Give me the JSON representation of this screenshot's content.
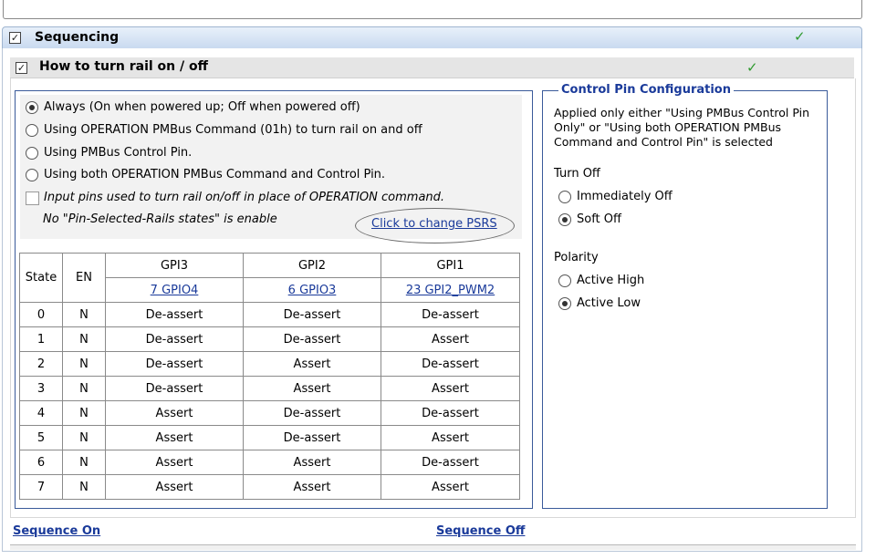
{
  "sequencing": {
    "title": "Sequencing",
    "checked": true
  },
  "how_to": {
    "title": "How to turn rail on / off",
    "checked": true
  },
  "options": [
    {
      "label": "Always (On when powered up; Off when powered off)",
      "selected": true
    },
    {
      "label": "Using OPERATION PMBus Command (01h) to turn rail on and off",
      "selected": false
    },
    {
      "label": "Using PMBus Control Pin.",
      "selected": false
    },
    {
      "label": "Using both OPERATION PMBus Command and Control Pin.",
      "selected": false
    }
  ],
  "input_pins_label": "Input pins used to turn rail on/off in place of OPERATION command.",
  "psrs_status": "No \"Pin-Selected-Rails states\" is enable",
  "psrs_link": "Click to change PSRS",
  "table": {
    "state_header": "State",
    "en_header": "EN",
    "gpi_headers": [
      "GPI3",
      "GPI2",
      "GPI1"
    ],
    "gpi_links": [
      "7 GPIO4",
      "6 GPIO3",
      "23 GPI2_PWM2"
    ],
    "rows": [
      [
        "0",
        "N",
        "De-assert",
        "De-assert",
        "De-assert"
      ],
      [
        "1",
        "N",
        "De-assert",
        "De-assert",
        "Assert"
      ],
      [
        "2",
        "N",
        "De-assert",
        "Assert",
        "De-assert"
      ],
      [
        "3",
        "N",
        "De-assert",
        "Assert",
        "Assert"
      ],
      [
        "4",
        "N",
        "Assert",
        "De-assert",
        "De-assert"
      ],
      [
        "5",
        "N",
        "Assert",
        "De-assert",
        "Assert"
      ],
      [
        "6",
        "N",
        "Assert",
        "Assert",
        "De-assert"
      ],
      [
        "7",
        "N",
        "Assert",
        "Assert",
        "Assert"
      ]
    ]
  },
  "control_pin": {
    "title": "Control Pin Configuration",
    "note_lines": [
      "Applied only either \"Using PMBus Control Pin",
      "Only\" or \"Using both OPERATION PMBus",
      "Command and Control Pin\" is selected"
    ],
    "turn_off_label": "Turn Off",
    "turn_off_options": [
      {
        "label": "Immediately Off",
        "selected": false
      },
      {
        "label": "Soft Off",
        "selected": true
      }
    ],
    "polarity_label": "Polarity",
    "polarity_options": [
      {
        "label": "Active High",
        "selected": false
      },
      {
        "label": "Active Low",
        "selected": true
      }
    ]
  },
  "sequence_on": "Sequence On",
  "sequence_off": "Sequence Off",
  "colors": {
    "accent": "#1a3a9a",
    "check": "#2f9a2f",
    "header_gradient_top": "#e8f0fa",
    "header_gradient_bottom": "#c9daf0"
  }
}
